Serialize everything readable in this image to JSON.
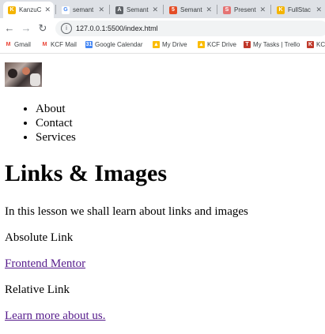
{
  "browser": {
    "tabs": [
      {
        "label": "KanzuC",
        "favicon": "K",
        "color": "#f4b400"
      },
      {
        "label": "semant",
        "favicon": "G",
        "color": "#4285f4"
      },
      {
        "label": "Semant",
        "favicon": "A",
        "color": "#5f6368"
      },
      {
        "label": "Semant",
        "favicon": "5",
        "color": "#e44d26"
      },
      {
        "label": "Present",
        "favicon": "S",
        "color": "#e57373"
      },
      {
        "label": "FullStac",
        "favicon": "K",
        "color": "#f4b400"
      }
    ],
    "url": "127.0.0.1:5500/index.html",
    "bookmarks": [
      {
        "label": "Gmail",
        "icon": "gmail-icon",
        "color": "#ea4335"
      },
      {
        "label": "KCF Mail",
        "icon": "gmail-icon",
        "color": "#ea4335"
      },
      {
        "label": "Google Calendar",
        "icon": "calendar-icon",
        "color": "#4285f4"
      },
      {
        "label": "My Drive",
        "icon": "drive-icon",
        "color": "#fbbc04"
      },
      {
        "label": "KCF Drive",
        "icon": "drive-icon",
        "color": "#fbbc04"
      },
      {
        "label": "My Tasks | Trello",
        "icon": "trello-icon",
        "color": "#c0392b"
      },
      {
        "label": "KC",
        "icon": "kc-icon",
        "color": "#c0392b"
      }
    ]
  },
  "page": {
    "nav": [
      "About",
      "Contact",
      "Services"
    ],
    "heading": "Links & Images",
    "intro": "In this lesson we shall learn about links and images",
    "absolute_label": "Absolute Link",
    "absolute_link": "Frontend Mentor",
    "relative_label": "Relative Link",
    "relative_link": "Learn more about us."
  }
}
